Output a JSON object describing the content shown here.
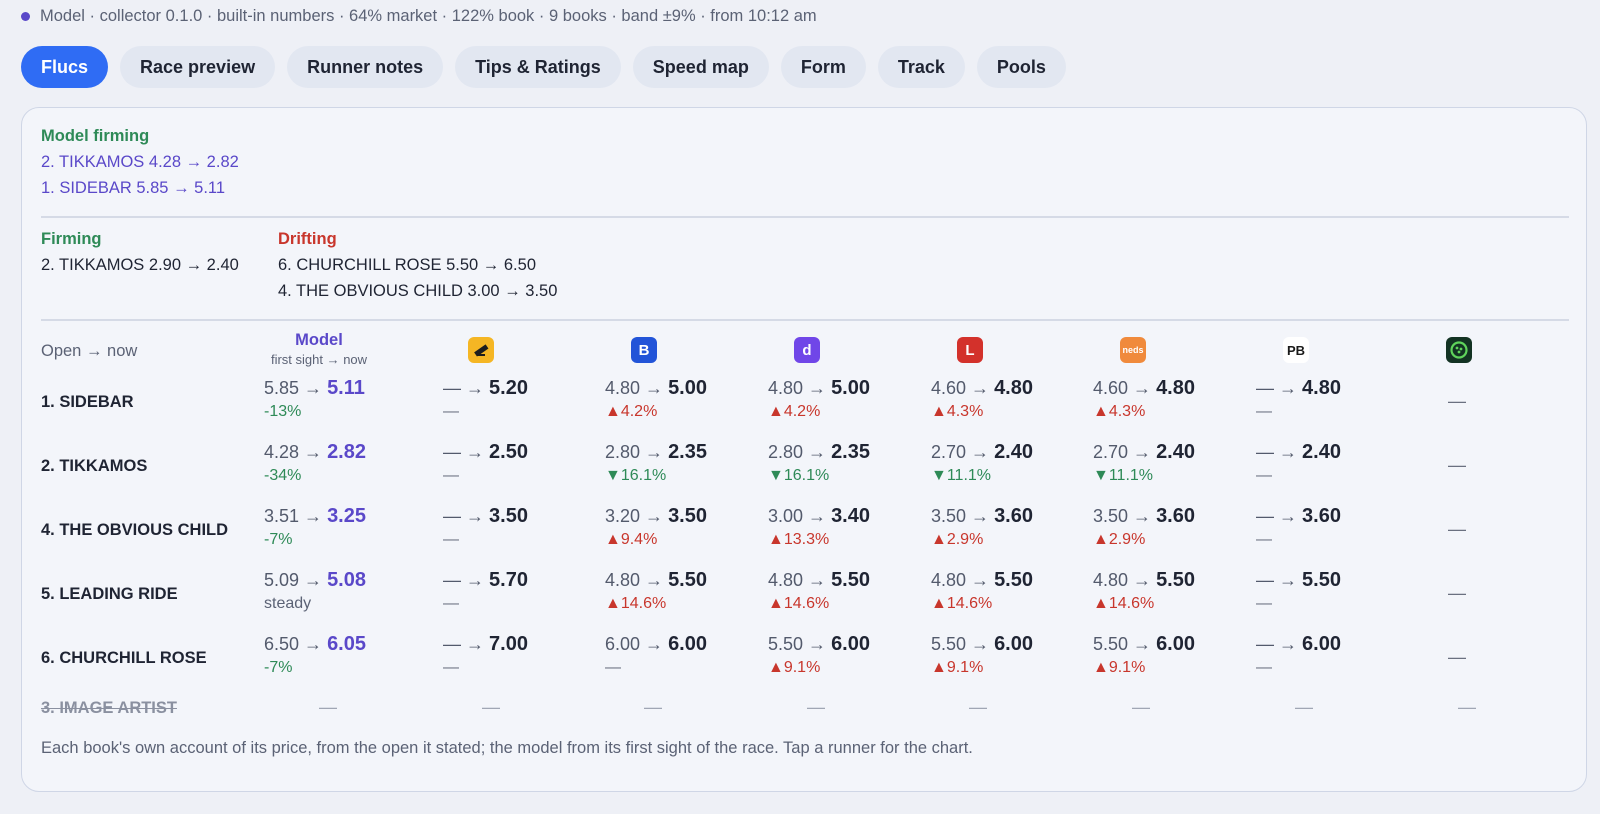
{
  "status": "Model · collector 0.1.0 · built-in numbers · 64% market · 122% book · 9 books · band ±9% · from 10:12 am",
  "tabs": [
    "Flucs",
    "Race preview",
    "Runner notes",
    "Tips & Ratings",
    "Speed map",
    "Form",
    "Track",
    "Pools"
  ],
  "model_firming": {
    "title": "Model firming",
    "items": [
      "2. TIKKAMOS  4.28 → 2.82",
      "1. SIDEBAR  5.85 → 5.11"
    ]
  },
  "firming": {
    "title": "Firming",
    "items": [
      "2. TIKKAMOS  2.90 → 2.40"
    ]
  },
  "drifting": {
    "title": "Drifting",
    "items": [
      "6. CHURCHILL ROSE  5.50 → 6.50",
      "4. THE OBVIOUS CHILD  3.00 → 3.50"
    ]
  },
  "table": {
    "open_now_label": "Open → now",
    "model_title": "Model",
    "model_subtitle": "first sight → now",
    "books": [
      {
        "icon": "betr-icon",
        "glyph": "",
        "color": "#f5b624"
      },
      {
        "icon": "bluebet-icon",
        "glyph": "B",
        "color": "#2254d8"
      },
      {
        "icon": "dabble-icon",
        "glyph": "d",
        "color": "#7046e8"
      },
      {
        "icon": "ladbrokes-icon",
        "glyph": "L",
        "color": "#d3312b"
      },
      {
        "icon": "neds-icon",
        "glyph": "neds",
        "color": "#f08a3c"
      },
      {
        "icon": "pointsbet-icon",
        "glyph": "PB",
        "color": "#ffffff"
      },
      {
        "icon": "unibet-icon",
        "glyph": "",
        "color": "#133323"
      }
    ],
    "rows": [
      {
        "name": "1. SIDEBAR",
        "model": {
          "from": "5.85",
          "to": "5.11",
          "chg": "-13%"
        },
        "books": [
          {
            "from": "—",
            "to": "5.20",
            "chg": "—",
            "dir": "none"
          },
          {
            "from": "4.80",
            "to": "5.00",
            "chg": "▲4.2%",
            "dir": "up"
          },
          {
            "from": "4.80",
            "to": "5.00",
            "chg": "▲4.2%",
            "dir": "up"
          },
          {
            "from": "4.60",
            "to": "4.80",
            "chg": "▲4.3%",
            "dir": "up"
          },
          {
            "from": "4.60",
            "to": "4.80",
            "chg": "▲4.3%",
            "dir": "up"
          },
          {
            "from": "—",
            "to": "4.80",
            "chg": "—",
            "dir": "none"
          }
        ],
        "last": "—"
      },
      {
        "name": "2. TIKKAMOS",
        "model": {
          "from": "4.28",
          "to": "2.82",
          "chg": "-34%"
        },
        "books": [
          {
            "from": "—",
            "to": "2.50",
            "chg": "—",
            "dir": "none"
          },
          {
            "from": "2.80",
            "to": "2.35",
            "chg": "▼16.1%",
            "dir": "down"
          },
          {
            "from": "2.80",
            "to": "2.35",
            "chg": "▼16.1%",
            "dir": "down"
          },
          {
            "from": "2.70",
            "to": "2.40",
            "chg": "▼11.1%",
            "dir": "down"
          },
          {
            "from": "2.70",
            "to": "2.40",
            "chg": "▼11.1%",
            "dir": "down"
          },
          {
            "from": "—",
            "to": "2.40",
            "chg": "—",
            "dir": "none"
          }
        ],
        "last": "—"
      },
      {
        "name": "4. THE OBVIOUS CHILD",
        "model": {
          "from": "3.51",
          "to": "3.25",
          "chg": "-7%"
        },
        "books": [
          {
            "from": "—",
            "to": "3.50",
            "chg": "—",
            "dir": "none"
          },
          {
            "from": "3.20",
            "to": "3.50",
            "chg": "▲9.4%",
            "dir": "up"
          },
          {
            "from": "3.00",
            "to": "3.40",
            "chg": "▲13.3%",
            "dir": "up"
          },
          {
            "from": "3.50",
            "to": "3.60",
            "chg": "▲2.9%",
            "dir": "up"
          },
          {
            "from": "3.50",
            "to": "3.60",
            "chg": "▲2.9%",
            "dir": "up"
          },
          {
            "from": "—",
            "to": "3.60",
            "chg": "—",
            "dir": "none"
          }
        ],
        "last": "—"
      },
      {
        "name": "5. LEADING RIDE",
        "model": {
          "from": "5.09",
          "to": "5.08",
          "chg": "steady"
        },
        "books": [
          {
            "from": "—",
            "to": "5.70",
            "chg": "—",
            "dir": "none"
          },
          {
            "from": "4.80",
            "to": "5.50",
            "chg": "▲14.6%",
            "dir": "up"
          },
          {
            "from": "4.80",
            "to": "5.50",
            "chg": "▲14.6%",
            "dir": "up"
          },
          {
            "from": "4.80",
            "to": "5.50",
            "chg": "▲14.6%",
            "dir": "up"
          },
          {
            "from": "4.80",
            "to": "5.50",
            "chg": "▲14.6%",
            "dir": "up"
          },
          {
            "from": "—",
            "to": "5.50",
            "chg": "—",
            "dir": "none"
          }
        ],
        "last": "—"
      },
      {
        "name": "6. CHURCHILL ROSE",
        "model": {
          "from": "6.50",
          "to": "6.05",
          "chg": "-7%"
        },
        "books": [
          {
            "from": "—",
            "to": "7.00",
            "chg": "—",
            "dir": "none"
          },
          {
            "from": "6.00",
            "to": "6.00",
            "chg": "—",
            "dir": "none"
          },
          {
            "from": "5.50",
            "to": "6.00",
            "chg": "▲9.1%",
            "dir": "up"
          },
          {
            "from": "5.50",
            "to": "6.00",
            "chg": "▲9.1%",
            "dir": "up"
          },
          {
            "from": "5.50",
            "to": "6.00",
            "chg": "▲9.1%",
            "dir": "up"
          },
          {
            "from": "—",
            "to": "6.00",
            "chg": "—",
            "dir": "none"
          }
        ],
        "last": "—"
      }
    ],
    "scratched": {
      "name": "3. IMAGE ARTIST",
      "cells": [
        "—",
        "—",
        "—",
        "—",
        "—",
        "—",
        "—",
        "—"
      ]
    }
  },
  "footer": "Each book's own account of its price, from the open it stated; the model from its first sight of the race. Tap a runner for the chart."
}
